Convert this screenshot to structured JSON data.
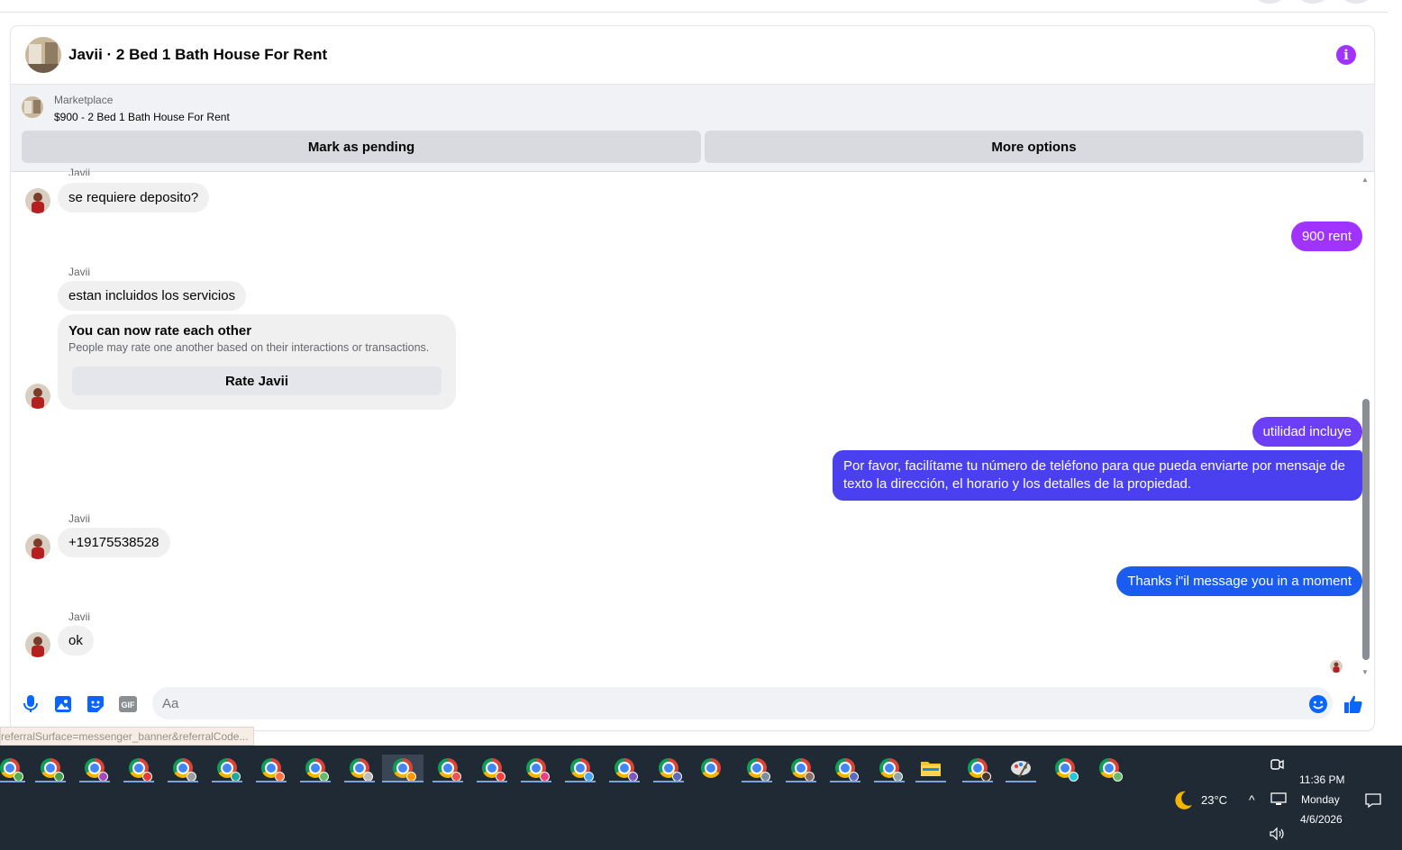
{
  "conversation": {
    "title": "Javii · 2 Bed 1 Bath House For Rent",
    "info_icon": "info-icon",
    "accent_color": "#a033ff"
  },
  "marketplace": {
    "label": "Marketplace",
    "item": "$900 - 2 Bed 1 Bath House For Rent",
    "mark_pending_label": "Mark as pending",
    "more_options_label": "More options"
  },
  "messages": {
    "top_sender": "Javii",
    "msg1": "se requiere deposito?",
    "msg2": "900 rent",
    "sender2": "Javii",
    "msg3": "estan incluidos los servicios",
    "rate_title": "You can now rate each other",
    "rate_desc": "People may rate one another based on their interactions or transactions.",
    "rate_button": "Rate Javii",
    "msg4": "utilidad incluye",
    "msg5_line1": "Por favor, facilítame tu número de teléfono para que pueda enviarte por mensaje de",
    "msg5_line2": "texto la dirección, el horario y los detalles de la propiedad.",
    "sender3": "Javii",
    "msg6": "+19175538528",
    "msg7": "Thanks i\"il message you in a moment",
    "sender4": "Javii",
    "msg8": "ok"
  },
  "composer": {
    "placeholder": "Aa",
    "icons": [
      "microphone-icon",
      "photo-icon",
      "sticker-icon",
      "gif-icon",
      "emoji-icon",
      "thumbs-up-icon"
    ],
    "gif_label": "GIF"
  },
  "status_bar": {
    "url": "referralSurface=messenger_banner&referralCode..."
  },
  "taskbar": {
    "weather_temp": "23°C",
    "time": "11:36 PM",
    "day": "Monday",
    "date": "4/6/2026"
  }
}
